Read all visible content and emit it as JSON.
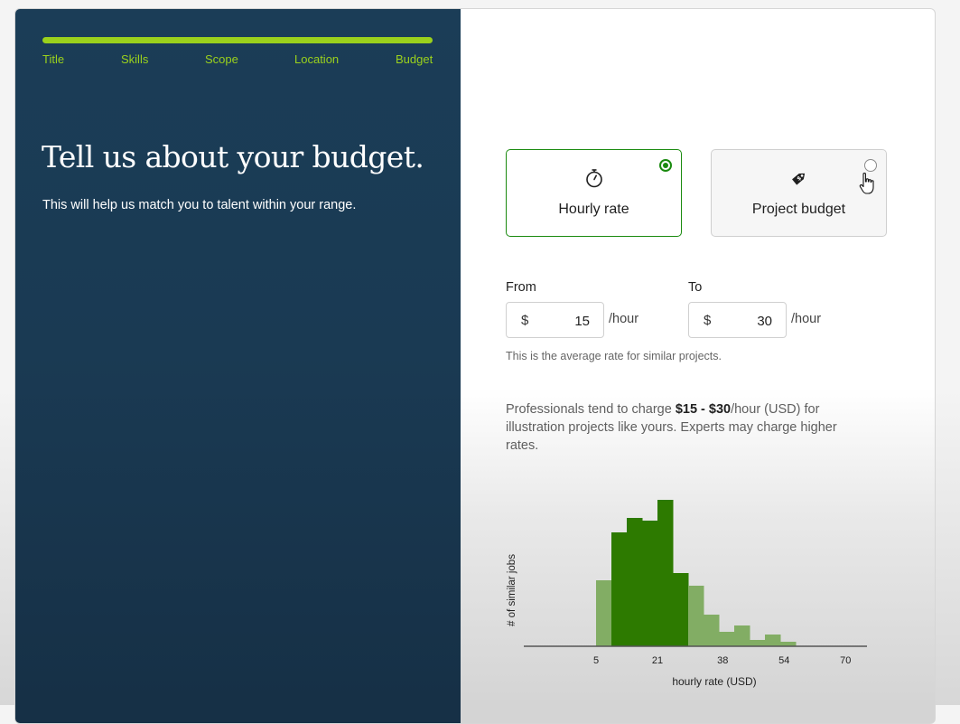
{
  "progress": {
    "steps": [
      "Title",
      "Skills",
      "Scope",
      "Location",
      "Budget"
    ],
    "fraction_complete": 1.0
  },
  "intro": {
    "headline": "Tell us about your budget.",
    "subtext": "This will help us match you to talent within your range."
  },
  "budget_type": {
    "options": [
      {
        "label": "Hourly rate",
        "icon": "stopwatch-icon",
        "selected": true
      },
      {
        "label": "Project budget",
        "icon": "price-tag-icon",
        "selected": false
      }
    ]
  },
  "rate": {
    "from_label": "From",
    "to_label": "To",
    "currency_symbol": "$",
    "from_value": "15",
    "to_value": "30",
    "unit": "/hour",
    "hint": "This is the average rate for similar projects."
  },
  "market_note": {
    "prefix": "Professionals tend to charge ",
    "range": "$15 - $30",
    "suffix": "/hour (USD) for illustration projects like yours. Experts may charge higher rates."
  },
  "chart_data": {
    "type": "bar",
    "xlabel": "hourly rate (USD)",
    "ylabel": "# of similar jobs",
    "xticks": [
      5,
      21,
      38,
      54,
      70
    ],
    "bins": [
      {
        "x0": 5,
        "x1": 9,
        "value": 73,
        "in_range": false
      },
      {
        "x0": 9,
        "x1": 13,
        "value": 126,
        "in_range": true
      },
      {
        "x0": 13,
        "x1": 17,
        "value": 142,
        "in_range": true
      },
      {
        "x0": 17,
        "x1": 21,
        "value": 139,
        "in_range": true
      },
      {
        "x0": 21,
        "x1": 25,
        "value": 162,
        "in_range": true
      },
      {
        "x0": 25,
        "x1": 29,
        "value": 81,
        "in_range": true
      },
      {
        "x0": 29,
        "x1": 33,
        "value": 67,
        "in_range": false
      },
      {
        "x0": 33,
        "x1": 37,
        "value": 35,
        "in_range": false
      },
      {
        "x0": 37,
        "x1": 41,
        "value": 16,
        "in_range": false
      },
      {
        "x0": 41,
        "x1": 45,
        "value": 23,
        "in_range": false
      },
      {
        "x0": 45,
        "x1": 49,
        "value": 7,
        "in_range": false
      },
      {
        "x0": 49,
        "x1": 53,
        "value": 13,
        "in_range": false
      },
      {
        "x0": 53,
        "x1": 57,
        "value": 5,
        "in_range": false
      }
    ],
    "colors": {
      "in_range": "#2d7a00",
      "out_of_range": "#82ad64",
      "axis": "#555555"
    },
    "grid": false
  },
  "colors": {
    "accent_green": "#1a8a0f",
    "progress_green": "#9bd11c",
    "panel_navy": "#1b3d57"
  }
}
